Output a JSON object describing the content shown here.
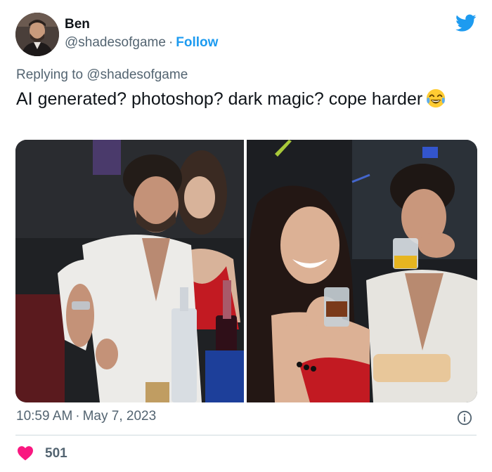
{
  "author": {
    "name": "Ben",
    "handle": "@shadesofgame",
    "separator": "·",
    "follow_label": "Follow"
  },
  "reply": {
    "prefix": "Replying to",
    "mention": "@shadesofgame"
  },
  "tweet": {
    "text": "AI generated? photoshop? dark magic? cope harder",
    "emoji": "face-with-tears-of-joy"
  },
  "media": [
    {
      "label": "photo-left"
    },
    {
      "label": "photo-right"
    }
  ],
  "meta": {
    "time": "10:59 AM",
    "separator": "·",
    "date": "May 7, 2023"
  },
  "engagement": {
    "likes": "501"
  },
  "colors": {
    "accent": "#1d9bf0",
    "secondary_text": "#536471",
    "heart": "#f91880",
    "divider": "#cfd9de"
  }
}
